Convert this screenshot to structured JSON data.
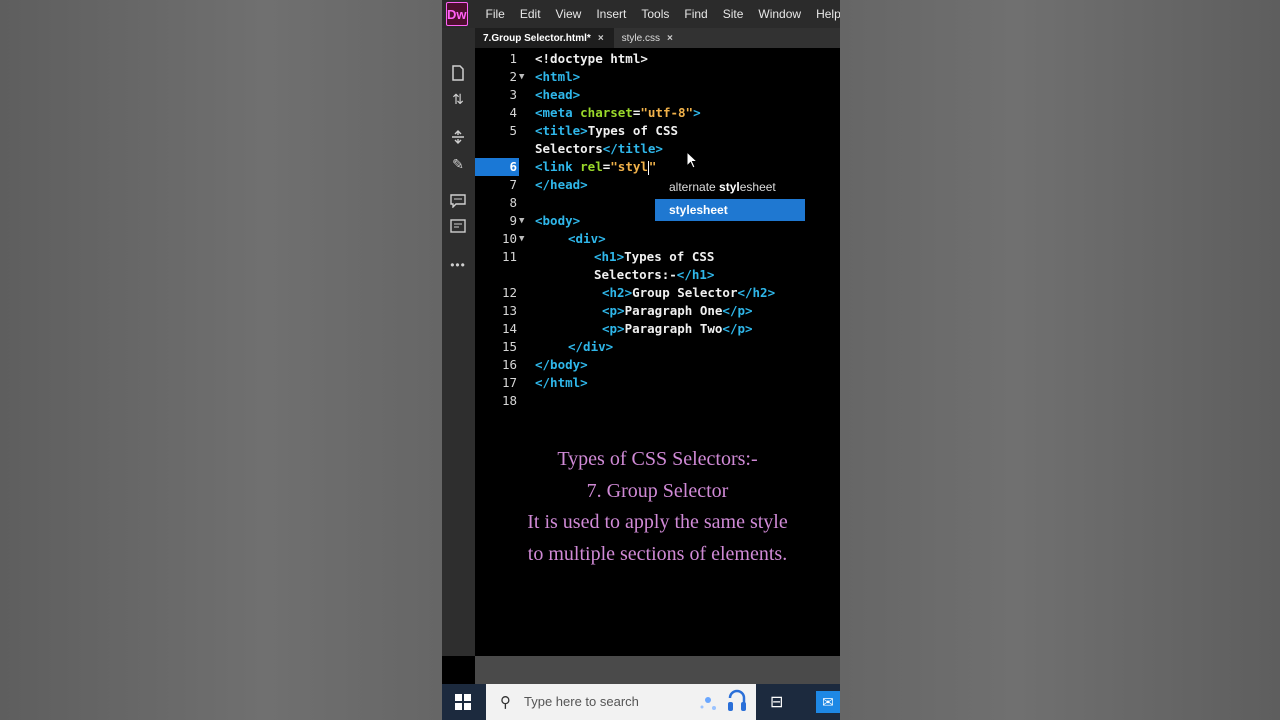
{
  "app": {
    "logo": "Dw"
  },
  "menu": [
    "File",
    "Edit",
    "View",
    "Insert",
    "Tools",
    "Find",
    "Site",
    "Window",
    "Help"
  ],
  "tabs": [
    {
      "label": "7.Group Selector.html*",
      "active": true
    },
    {
      "label": "style.css",
      "active": false
    }
  ],
  "toolbar_icons": [
    "file-icon",
    "sort-icon",
    "split-icon",
    "brush-icon",
    "comment-icon",
    "css-designer-icon",
    "more-icon"
  ],
  "editor": {
    "current_line": 6,
    "lines": [
      {
        "n": "1",
        "fold": ""
      },
      {
        "n": "2",
        "fold": "▼"
      },
      {
        "n": "3",
        "fold": ""
      },
      {
        "n": "4",
        "fold": ""
      },
      {
        "n": "5",
        "fold": ""
      },
      {
        "n": "",
        "fold": ""
      },
      {
        "n": "6",
        "fold": ""
      },
      {
        "n": "7",
        "fold": ""
      },
      {
        "n": "8",
        "fold": ""
      },
      {
        "n": "9",
        "fold": "▼"
      },
      {
        "n": "10",
        "fold": "▼"
      },
      {
        "n": "11",
        "fold": ""
      },
      {
        "n": "",
        "fold": ""
      },
      {
        "n": "12",
        "fold": ""
      },
      {
        "n": "13",
        "fold": ""
      },
      {
        "n": "14",
        "fold": ""
      },
      {
        "n": "15",
        "fold": ""
      },
      {
        "n": "16",
        "fold": ""
      },
      {
        "n": "17",
        "fold": ""
      },
      {
        "n": "18",
        "fold": ""
      }
    ],
    "code": {
      "l1": "<!doctype html>",
      "l2": "<html>",
      "l3": "<head>",
      "l4a": "<meta ",
      "l4b": "charset",
      "l4c": "=",
      "l4d": "\"utf-8\"",
      "l4e": ">",
      "l5a": "<title>",
      "l5b": "Types of CSS",
      "l5c": "Selectors",
      "l5d": "</title>",
      "l6a": "<link ",
      "l6b": "rel",
      "l6c": "=",
      "l6d": "\"styl",
      "l7": "</head>",
      "l9": "<body>",
      "l10": "<div>",
      "l11a": "<h1>",
      "l11b": "Types of CSS",
      "l11c": "Selectors:-",
      "l11d": "</h1>",
      "l12a": "<h2>",
      "l12b": "Group Selector",
      "l12c": "</h2>",
      "l13a": "<p>",
      "l13b": "Paragraph One",
      "l13c": "</p>",
      "l14a": "<p>",
      "l14b": "Paragraph Two",
      "l14c": "</p>",
      "l15": "</div>",
      "l16": "</body>",
      "l17": "</html>"
    },
    "autocomplete": {
      "items": [
        {
          "prefix": "alternate ",
          "match": "styl",
          "rest": "esheet"
        },
        {
          "prefix": "",
          "match": "styl",
          "rest": "esheet"
        }
      ],
      "selected_index": 1
    }
  },
  "caption": {
    "line1": "Types of CSS Selectors:-",
    "line2": "7. Group Selector",
    "line3": "It is used to apply the same style",
    "line4": "to multiple sections of elements."
  },
  "taskbar": {
    "search_placeholder": "Type here to search"
  },
  "colors": {
    "tag": "#2fb7ea",
    "attribute": "#9ad82a",
    "string": "#f1b24a",
    "caption": "#d08ad6",
    "selection": "#1f78d1"
  }
}
